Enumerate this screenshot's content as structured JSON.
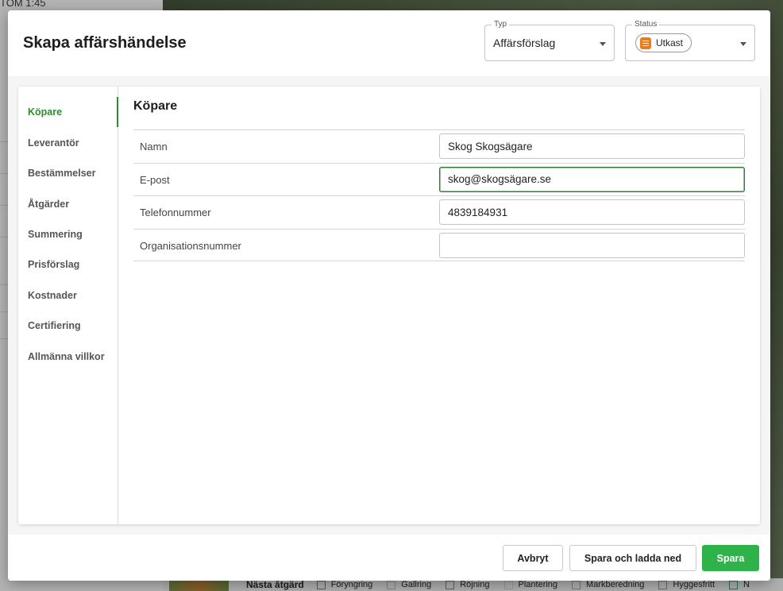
{
  "background": {
    "top_text": "TOM 1:45",
    "legend": {
      "title": "Nästa åtgärd",
      "items": [
        {
          "label": "Föryngring",
          "color": "#9b3fa8"
        },
        {
          "label": "Gallring",
          "color": "#e08a2a"
        },
        {
          "label": "Röjning",
          "color": "#3a78c9"
        },
        {
          "label": "Plantering",
          "color": "#d6b33a"
        },
        {
          "label": "Markberedning",
          "color": "#8a8a8a"
        },
        {
          "label": "Hyggesfritt",
          "color": "#3aa84a"
        },
        {
          "label": "N",
          "color": "#2e8b57"
        }
      ]
    }
  },
  "modal": {
    "title": "Skapa affärshändelse",
    "type_field": {
      "label": "Typ",
      "value": "Affärsförslag"
    },
    "status_field": {
      "label": "Status",
      "value": "Utkast",
      "color": "#f07a1a"
    },
    "nav": {
      "items": [
        {
          "label": "Köpare",
          "active": true
        },
        {
          "label": "Leverantör",
          "active": false
        },
        {
          "label": "Bestämmelser",
          "active": false
        },
        {
          "label": "Åtgärder",
          "active": false
        },
        {
          "label": "Summering",
          "active": false
        },
        {
          "label": "Prisförslag",
          "active": false
        },
        {
          "label": "Kostnader",
          "active": false
        },
        {
          "label": "Certifiering",
          "active": false
        },
        {
          "label": "Allmänna villkor",
          "active": false
        }
      ]
    },
    "section": {
      "title": "Köpare",
      "fields": [
        {
          "label": "Namn",
          "value": "Skog Skogsägare"
        },
        {
          "label": "E-post",
          "value": "skog@skogsägare.se"
        },
        {
          "label": "Telefonnummer",
          "value": "4839184931"
        },
        {
          "label": "Organisationsnummer",
          "value": ""
        }
      ]
    },
    "footer": {
      "cancel_label": "Avbryt",
      "save_download_label": "Spara och ladda ned",
      "save_label": "Spara"
    },
    "accent_color": "#2e8b2e",
    "primary_color": "#2db34a"
  }
}
